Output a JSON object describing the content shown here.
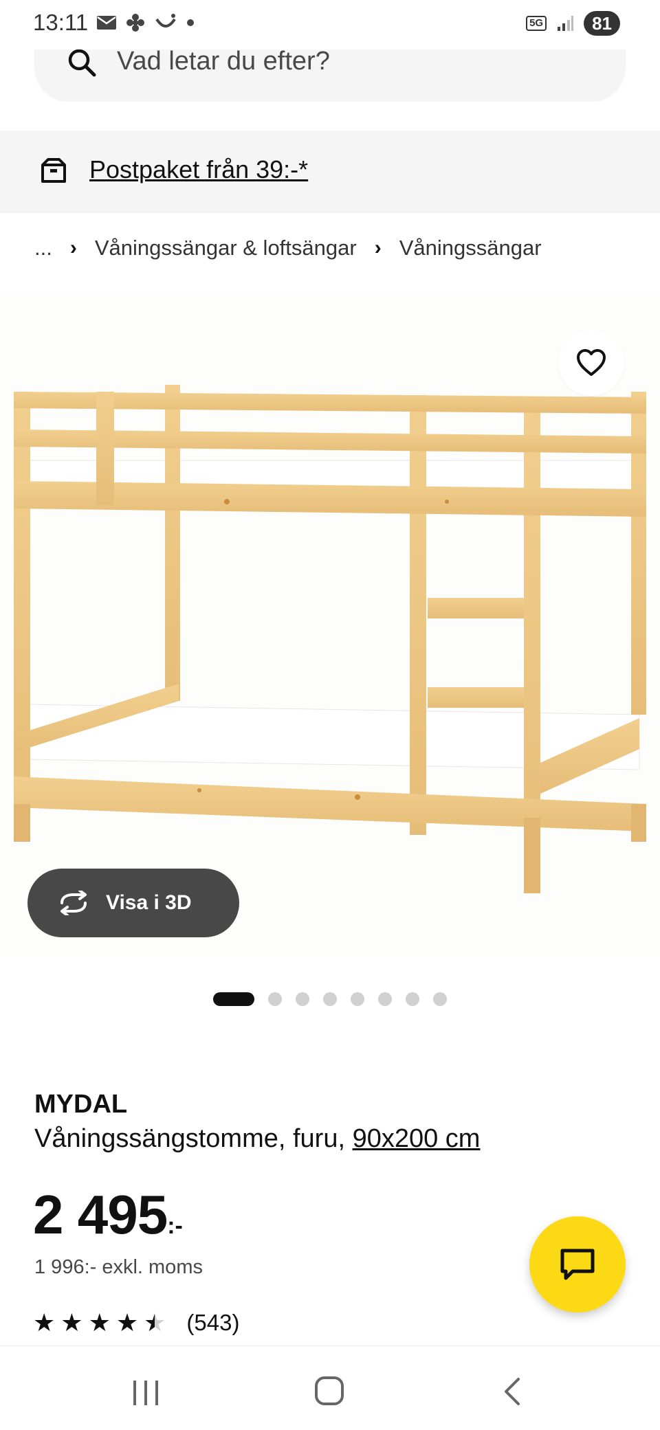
{
  "status_bar": {
    "time": "13:11",
    "network": "5G",
    "battery": "81"
  },
  "search": {
    "placeholder": "Vad letar du efter?"
  },
  "shipping_banner": {
    "text": "Postpaket från 39:-*"
  },
  "breadcrumb": {
    "items": [
      "...",
      "Våningssängar & loftsängar",
      "Våningssängar"
    ]
  },
  "image_actions": {
    "view3d_label": "Visa i 3D"
  },
  "carousel": {
    "total": 8,
    "active_index": 0
  },
  "product": {
    "name": "MYDAL",
    "description": "Våningssängstomme, furu, ",
    "size": "90x200 cm",
    "price_main": "2 495",
    "price_suffix": ":-",
    "price_excl_vat": "1 996:- exkl. moms",
    "rating_value": 4.5,
    "rating_count": "(543)"
  },
  "colors": {
    "accent_yellow": "#fbd914",
    "dark_button": "#484848",
    "banner_bg": "#f5f5f5"
  }
}
